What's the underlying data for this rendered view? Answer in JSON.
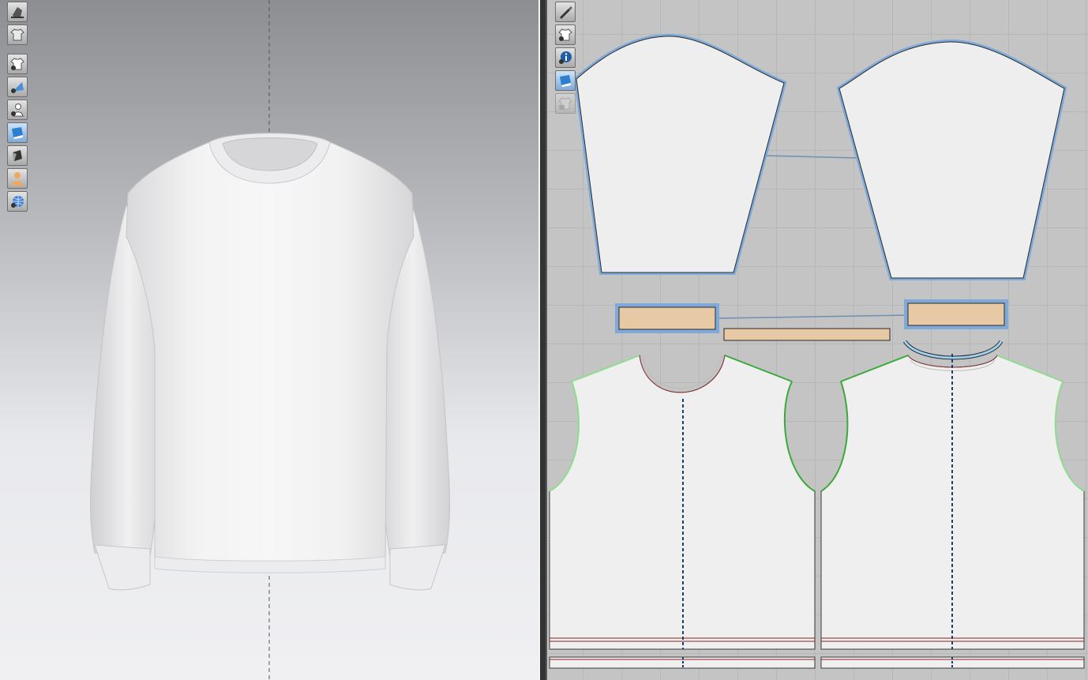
{
  "viewport3d": {
    "toolbar": [
      {
        "icon": "avatar-display-icon"
      },
      {
        "icon": "garment-display-icon"
      },
      {
        "icon": "garment-visibility-icon"
      },
      {
        "icon": "texture-display-icon"
      },
      {
        "icon": "avatar-visibility-icon"
      },
      {
        "icon": "fabric-display-icon"
      },
      {
        "icon": "shading-display-icon"
      },
      {
        "icon": "avatar-skin-icon"
      },
      {
        "icon": "environment-display-icon"
      }
    ],
    "background_top": "#8d8e92",
    "background_bottom": "#f0f0f3"
  },
  "viewport2d": {
    "toolbar": [
      {
        "icon": "pen-display-icon"
      },
      {
        "icon": "pattern-display-icon"
      },
      {
        "icon": "info-display-icon"
      },
      {
        "icon": "texture-2d-display-icon",
        "active": true
      },
      {
        "icon": "lock-pattern-icon",
        "disabled": true
      }
    ],
    "colors": {
      "selected_outline": "#6d9fd3",
      "rib_fabric": "#e8c9a6",
      "seam_green": "#3aaa3a",
      "seam_light_green": "#8fdc8f",
      "grain_line": "#1a3f6b",
      "pattern_fill": "#efefef"
    }
  }
}
